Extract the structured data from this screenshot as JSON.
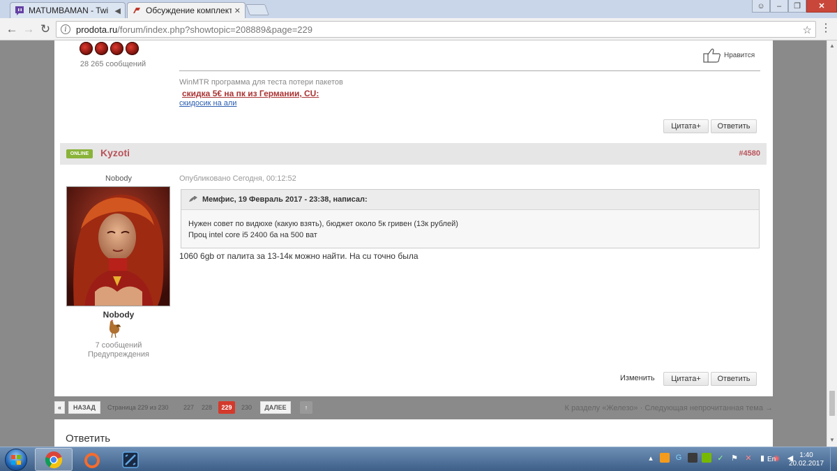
{
  "browser": {
    "tabs": [
      {
        "title": "MATUMBAMAN - Twi",
        "icon": "twitch-icon",
        "extra": "speaker-icon"
      },
      {
        "title": "Обсуждение комплекту",
        "icon": "prodota-icon",
        "extra": "close-icon"
      }
    ],
    "url_host": "prodota.ru",
    "url_path": "/forum/index.php?showtopic=208889&page=229"
  },
  "prev_post": {
    "message_count": "28 265 сообщений",
    "like_label": "Нравится",
    "signature_line1": "WinMTR программа для теста потери пакетов",
    "signature_line2": "скидка 5€ на пк из Германии, CU:",
    "signature_line3": "скидосик на али",
    "quote_button": "Цитата+",
    "reply_button": "Ответить"
  },
  "post": {
    "online_badge": "ONLINE",
    "author": "Kyzoti",
    "post_number": "#4580",
    "user_title": "Nobody",
    "user_group": "Nobody",
    "message_count": "7 сообщений",
    "warnings": "Предупреждения",
    "published": "Опубликовано Сегодня, 00:12:52",
    "quote_header": "Мемфис, 19 Февраль 2017 - 23:38, написал:",
    "quote_line1": "Нужен совет по видюхе (какую взять), бюджет около 5к гривен (13к рублей)",
    "quote_line2": "Проц intel core i5 2400 ба на 500 ват",
    "body": "1060 6gb от палита за 13-14к можно найти. На cu точно была",
    "edit_label": "Изменить",
    "quote_button": "Цитата+",
    "reply_button": "Ответить"
  },
  "pagination": {
    "first": "«",
    "back": "НАЗАД",
    "page_info": "Страница 229 из 230",
    "pages": [
      "227",
      "228",
      "229",
      "230"
    ],
    "current": "229",
    "next": "ДАЛЕЕ",
    "up": "↑",
    "right_links": "К разделу «Железо» · Следующая непрочитанная тема →"
  },
  "reply": {
    "title": "Ответить"
  },
  "taskbar": {
    "apps": [
      "chrome-icon",
      "origin-icon",
      "dota-icon"
    ],
    "lang": "En",
    "time": "1:40",
    "date": "20.02.2017"
  }
}
